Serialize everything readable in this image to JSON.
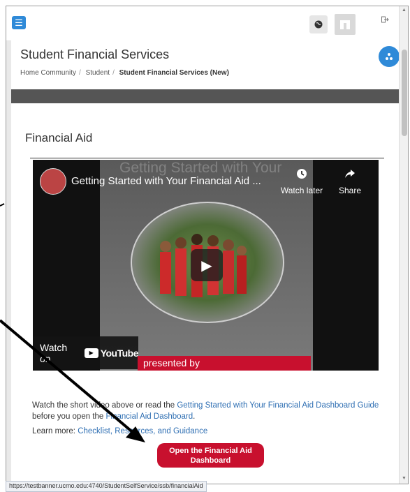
{
  "topbar": {
    "menu_icon": "hamburger-menu-icon",
    "globe_icon": "globe-icon",
    "avatar_icon": "user-avatar",
    "logout_icon": "sign-out-icon"
  },
  "header": {
    "title": "Student Financial Services",
    "breadcrumb": [
      "Home Community",
      "Student",
      "Student Financial Services (New)"
    ],
    "fab_icon": "sitemap-icon"
  },
  "section": {
    "title": "Financial Aid"
  },
  "video": {
    "ghost_title": "Getting Started with Your",
    "title": "Getting Started with Your Financial Aid ...",
    "watch_later": "Watch later",
    "share": "Share",
    "watch_on": "Watch on",
    "youtube": "YouTube",
    "presented": "presented by"
  },
  "body": {
    "para_1": "Watch the short video above or read the ",
    "guide_link": "Getting Started with Your Financial Aid Dashboard Guide",
    "para_2": " before you open the ",
    "dashboard_link": "Financial Aid Dashboard",
    "para_3": ".",
    "learn_label": "Learn more: ",
    "learn_link": "Checklist, Resources, and Guidance",
    "cta_label": "Open the Financial Aid Dashboard"
  },
  "status_url": "https://testbanner.ucmo.edu:4740/StudentSelfService/ssb/financialAid",
  "colors": {
    "accent_blue": "#2f8ad8",
    "brand_red": "#c8102e",
    "link": "#2f6fb3"
  }
}
